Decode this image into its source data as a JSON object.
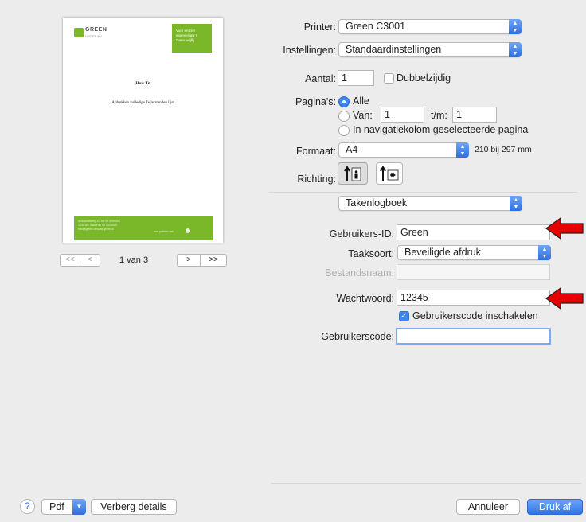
{
  "preview": {
    "logo_text": "GREEN",
    "logo_sub": "GROEP BV",
    "badge_lines": [
      "Voor en ziet",
      "eigen/eiligw s",
      "Geen wrijflij"
    ],
    "title": "How To",
    "subtitle": "Afdrukken volledige Tellerstanden lijst",
    "footer_left": [
      "Ambachtsweg 10  Tel 00 0000000",
      "1234 AB Stad  Fax 00 0000000",
      "info@green.nl  www.green.nl"
    ],
    "footer_brand": "een partner van",
    "page_indicator": "1 van 3"
  },
  "nav": {
    "first": "<<",
    "prev": "<",
    "next": ">",
    "last": ">>"
  },
  "form": {
    "printer": {
      "label": "Printer:",
      "value": "Green C3001"
    },
    "instellingen": {
      "label": "Instellingen:",
      "value": "Standaardinstellingen"
    },
    "aantal": {
      "label": "Aantal:",
      "value": "1"
    },
    "dubbelzijdig": {
      "label": "Dubbelzijdig",
      "checked": false
    },
    "paginas": {
      "label": "Pagina's:",
      "alle": "Alle",
      "van": "Van:",
      "van_value": "1",
      "tm": "t/m:",
      "tm_value": "1",
      "navigatie": "In navigatiekolom geselecteerde pagina"
    },
    "formaat": {
      "label": "Formaat:",
      "value": "A4",
      "size_text": "210 bij 297 mm"
    },
    "richting": {
      "label": "Richting:"
    },
    "section": {
      "value": "Takenlogboek"
    },
    "gebruikers_id": {
      "label": "Gebruikers-ID:",
      "value": "Green"
    },
    "taaksoort": {
      "label": "Taaksoort:",
      "value": "Beveiligde afdruk"
    },
    "bestandsnaam": {
      "label": "Bestandsnaam:",
      "value": ""
    },
    "wachtwoord": {
      "label": "Wachtwoord:",
      "value": "12345"
    },
    "gebruikerscode_inschakelen": {
      "label": "Gebruikerscode inschakelen",
      "checked": true
    },
    "gebruikerscode": {
      "label": "Gebruikerscode:",
      "value": ""
    }
  },
  "bottom": {
    "help": "?",
    "pdf": "Pdf",
    "verberg": "Verberg details",
    "annuleer": "Annuleer",
    "druk_af": "Druk af"
  },
  "colors": {
    "accent": "#3d86f2",
    "arrow_red": "#e60000",
    "preview_green": "#7ab829"
  }
}
